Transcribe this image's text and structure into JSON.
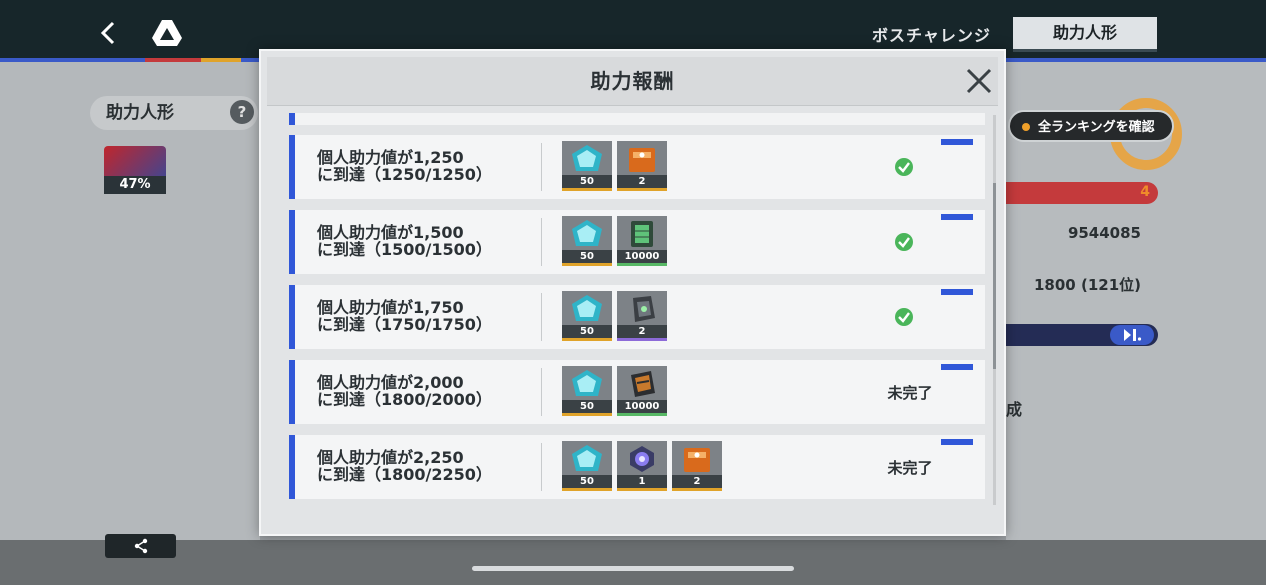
{
  "background": {
    "tabs": [
      "ボスチャレンジ",
      "助力人形"
    ],
    "left_panel": {
      "label": "助力人形",
      "help": "?",
      "progress": "47%"
    },
    "right_panel": {
      "ranking_button": "全ランキングを確認",
      "red_bar_value": "4",
      "score": "9544085",
      "rank": "1800 (121位)",
      "partial_text": "成"
    }
  },
  "modal": {
    "title": "助力報酬",
    "rows": [
      {
        "line1": "個人助力値が1,250",
        "line2": "に到達（1250/1250）",
        "items": [
          {
            "icon": "crystal-icon",
            "qty": "50",
            "rarity": "gold"
          },
          {
            "icon": "supply-box-icon",
            "qty": "2",
            "rarity": "gold"
          }
        ],
        "status": "complete"
      },
      {
        "line1": "個人助力値が1,500",
        "line2": "に到達（1500/1500）",
        "items": [
          {
            "icon": "crystal-icon",
            "qty": "50",
            "rarity": "gold"
          },
          {
            "icon": "chip-icon",
            "qty": "10000",
            "rarity": "green"
          }
        ],
        "status": "complete"
      },
      {
        "line1": "個人助力値が1,750",
        "line2": "に到達（1750/1750）",
        "items": [
          {
            "icon": "crystal-icon",
            "qty": "50",
            "rarity": "gold"
          },
          {
            "icon": "module-icon",
            "qty": "2",
            "rarity": "purple"
          }
        ],
        "status": "complete"
      },
      {
        "line1": "個人助力値が2,000",
        "line2": "に到達（1800/2000）",
        "items": [
          {
            "icon": "crystal-icon",
            "qty": "50",
            "rarity": "gold"
          },
          {
            "icon": "ticket-icon",
            "qty": "10000",
            "rarity": "green"
          }
        ],
        "status": "未完了"
      },
      {
        "line1": "個人助力値が2,250",
        "line2": "に到達（1800/2250）",
        "items": [
          {
            "icon": "crystal-icon",
            "qty": "50",
            "rarity": "gold"
          },
          {
            "icon": "core-icon",
            "qty": "1",
            "rarity": "gold"
          },
          {
            "icon": "supply-box-icon",
            "qty": "2",
            "rarity": "gold"
          }
        ],
        "status": "未完了"
      }
    ]
  },
  "colors": {
    "accent_blue": "#3057d8",
    "complete_green": "#4ab55a",
    "rarity_gold": "#e0a32a",
    "rarity_green": "#57b865",
    "rarity_purple": "#8c6ad8"
  }
}
